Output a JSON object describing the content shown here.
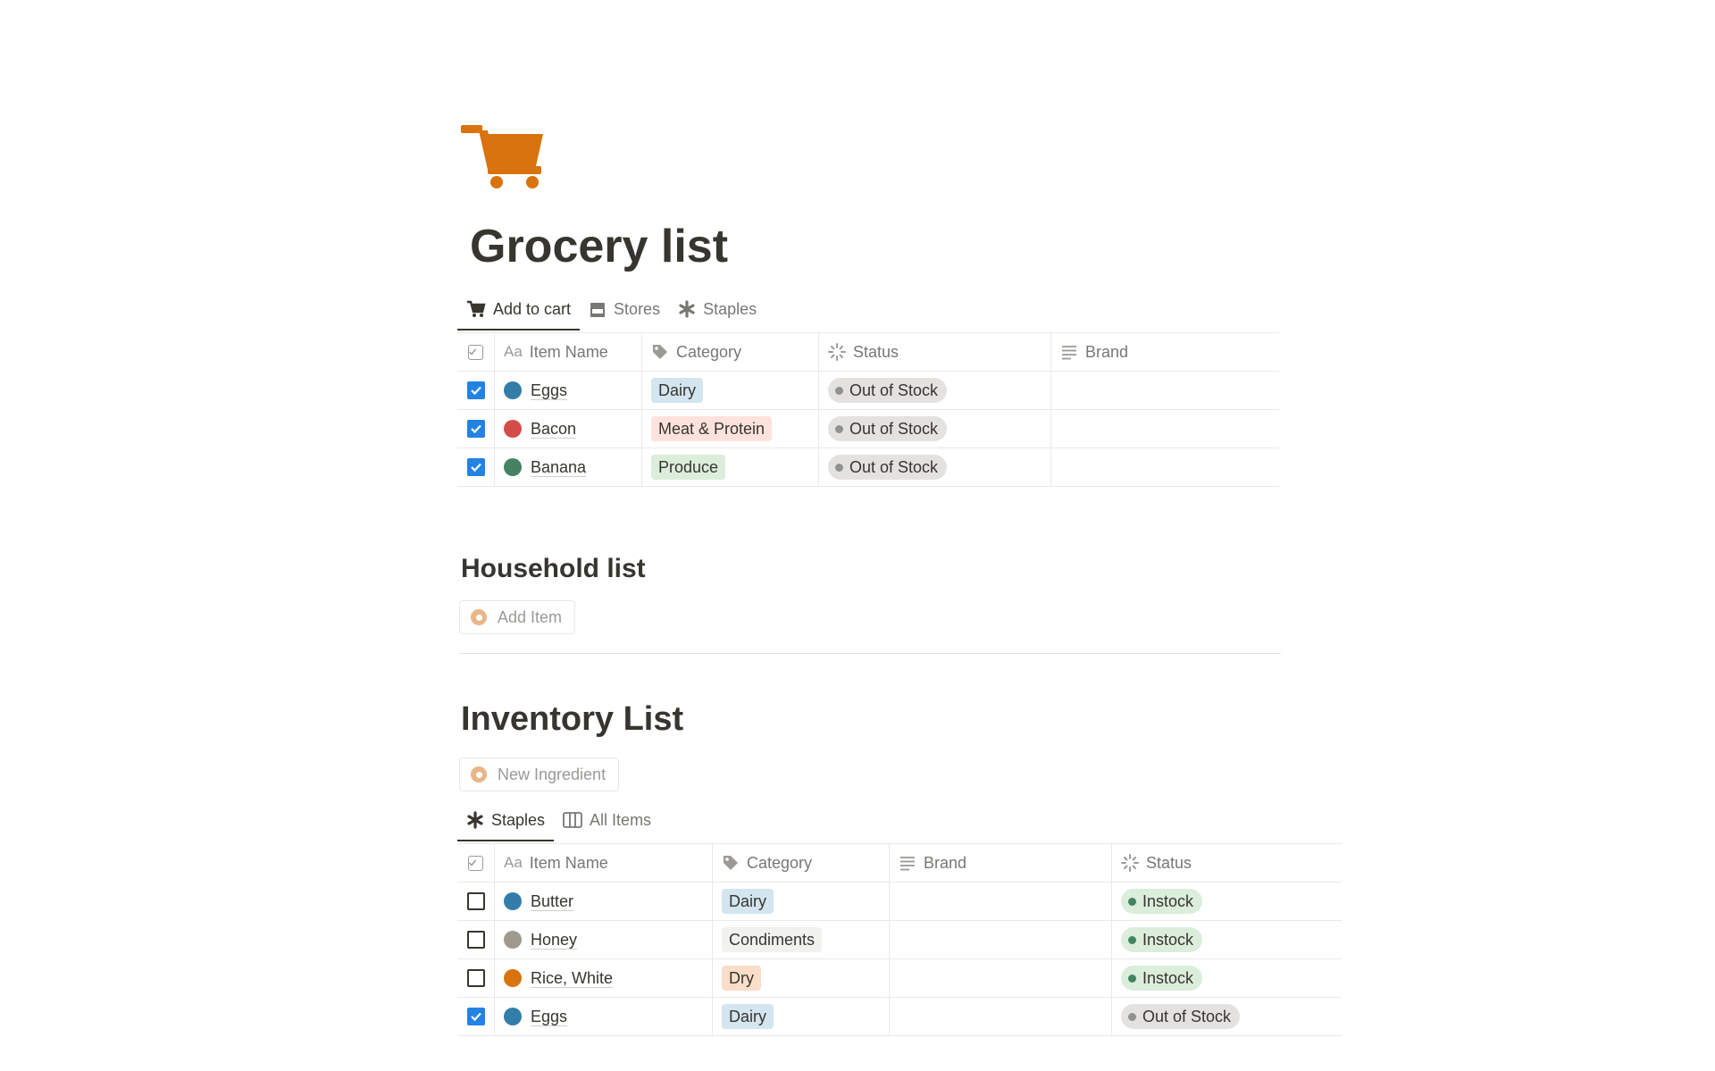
{
  "page": {
    "title": "Grocery list",
    "icon": "shopping-cart-icon",
    "icon_color": "#d9730d"
  },
  "grocery": {
    "tabs": [
      {
        "label": "Add to cart",
        "icon": "cart-icon",
        "active": true
      },
      {
        "label": "Stores",
        "icon": "store-icon",
        "active": false
      },
      {
        "label": "Staples",
        "icon": "asterisk-icon",
        "active": false
      }
    ],
    "columns": [
      "Item Name",
      "Category",
      "Status",
      "Brand"
    ],
    "rows": [
      {
        "checked": true,
        "name": "Eggs",
        "dot": "#337ea9",
        "category": "Dairy",
        "category_color": "#d3e5ef",
        "status": "Out of Stock",
        "brand": ""
      },
      {
        "checked": true,
        "name": "Bacon",
        "dot": "#d44c47",
        "category": "Meat & Protein",
        "category_color": "#ffe2dd",
        "status": "Out of Stock",
        "brand": ""
      },
      {
        "checked": true,
        "name": "Banana",
        "dot": "#448361",
        "category": "Produce",
        "category_color": "#dbeddb",
        "status": "Out of Stock",
        "brand": ""
      }
    ]
  },
  "household": {
    "heading": "Household list",
    "add_button": "Add Item"
  },
  "inventory": {
    "heading": "Inventory List",
    "add_button": "New Ingredient",
    "tabs": [
      {
        "label": "Staples",
        "icon": "asterisk-icon",
        "active": true
      },
      {
        "label": "All Items",
        "icon": "board-icon",
        "active": false
      }
    ],
    "columns": [
      "Item Name",
      "Category",
      "Brand",
      "Status"
    ],
    "rows": [
      {
        "checked": false,
        "name": "Butter",
        "dot": "#337ea9",
        "category": "Dairy",
        "category_color": "#d3e5ef",
        "brand": "",
        "status": "Instock"
      },
      {
        "checked": false,
        "name": "Honey",
        "dot": "#9f9a8e",
        "category": "Condiments",
        "category_color": "#f1f1ef",
        "brand": "",
        "status": "Instock"
      },
      {
        "checked": false,
        "name": "Rice, White",
        "dot": "#d9730d",
        "category": "Dry",
        "category_color": "#fadec9",
        "brand": "",
        "status": "Instock"
      },
      {
        "checked": true,
        "name": "Eggs",
        "dot": "#337ea9",
        "category": "Dairy",
        "category_color": "#d3e5ef",
        "brand": "",
        "status": "Out of Stock"
      }
    ]
  },
  "status_styles": {
    "Out of Stock": {
      "bg": "#e3e2e0",
      "dot": "#91918e"
    },
    "Instock": {
      "bg": "#dbeddb",
      "dot": "#448361"
    }
  }
}
